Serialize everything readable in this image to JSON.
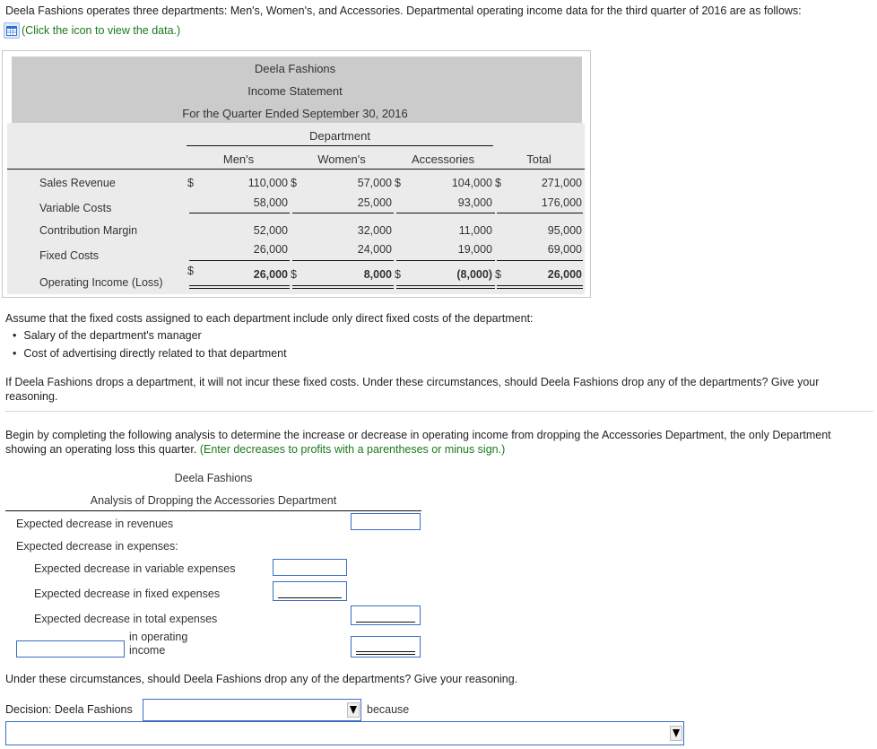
{
  "intro": {
    "text": "Deela Fashions operates three departments: Men's, Women's, and Accessories. Departmental operating income data for the third quarter of 2016 are as follows:",
    "data_link": "(Click the icon to view the data.)",
    "data_icon": "table-grid-icon"
  },
  "statement": {
    "company": "Deela Fashions",
    "title": "Income Statement",
    "period": "For the Quarter Ended September 30, 2016",
    "group_header": "Department",
    "columns": [
      "Men's",
      "Women's",
      "Accessories",
      "Total"
    ],
    "currency": "$",
    "rows": [
      {
        "label": "Sales Revenue",
        "values": [
          "110,000",
          "57,000",
          "104,000",
          "271,000"
        ]
      },
      {
        "label": "Variable Costs",
        "values": [
          "58,000",
          "25,000",
          "93,000",
          "176,000"
        ]
      },
      {
        "label": "Contribution Margin",
        "values": [
          "52,000",
          "32,000",
          "11,000",
          "95,000"
        ]
      },
      {
        "label": "Fixed Costs",
        "values": [
          "26,000",
          "24,000",
          "19,000",
          "69,000"
        ]
      },
      {
        "label": "Operating Income (Loss)",
        "values": [
          "26,000",
          "8,000",
          "(8,000)",
          "26,000"
        ]
      }
    ]
  },
  "assumption": {
    "lead": "Assume that the fixed costs assigned to each department include only direct fixed costs of the department:",
    "bullets": [
      "Salary of the department's manager",
      "Cost of advertising directly related to that department"
    ],
    "question_line1": "If Deela Fashions drops a department, it will not incur these fixed costs. Under these circumstances, should Deela Fashions drop any of the departments? Give your",
    "question_line2": "reasoning."
  },
  "instructions": {
    "line1": "Begin by completing the following analysis to determine the increase or decrease in operating income from dropping the Accessories Department, the only Department",
    "line2": "showing an operating loss this quarter.",
    "hint": "(Enter decreases to profits with a parentheses or minus sign.)"
  },
  "analysis": {
    "company": "Deela Fashions",
    "title": "Analysis of Dropping the Accessories Department",
    "rows": {
      "revenues": "Expected decrease in revenues",
      "expenses_header": "Expected decrease in expenses:",
      "variable": "Expected decrease in variable expenses",
      "fixed": "Expected decrease in fixed expenses",
      "total": "Expected decrease in total expenses",
      "operating_suffix_1": "in operating",
      "operating_suffix_2": "income"
    },
    "inputs": {
      "revenues": "",
      "variable": "",
      "fixed": "",
      "total": "",
      "operating_label_select": "",
      "operating": ""
    }
  },
  "decision": {
    "question": "Under these circumstances, should Deela Fashions drop any of the departments? Give your reasoning.",
    "label": "Decision: Deela Fashions",
    "decision_value": "",
    "because": "because",
    "reason_value": ""
  }
}
